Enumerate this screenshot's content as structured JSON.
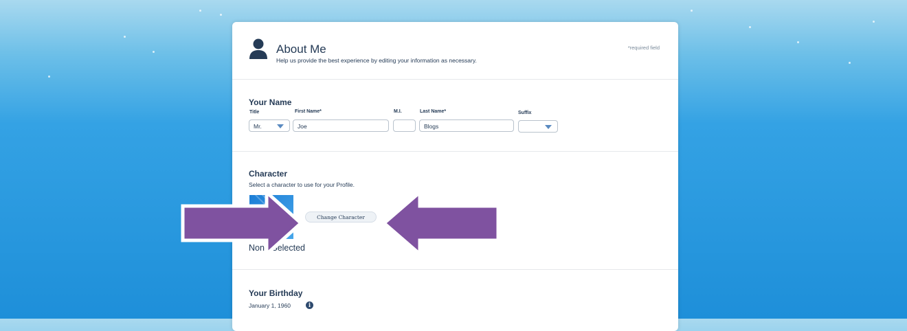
{
  "header": {
    "title": "About Me",
    "subtitle": "Help us provide the best experience by editing your information as necessary.",
    "required_note": "*required field",
    "icon": "person-icon"
  },
  "name_section": {
    "heading": "Your Name",
    "labels": {
      "title": "Title",
      "first_name": "First Name*",
      "middle_initial": "M.I.",
      "last_name": "Last Name*",
      "suffix": "Suffix"
    },
    "values": {
      "title": "Mr.",
      "first_name": "Joe",
      "middle_initial": "",
      "last_name": "Blogs",
      "suffix": ""
    }
  },
  "character_section": {
    "heading": "Character",
    "subtitle": "Select a character to use for your Profile.",
    "change_button": "Change Character",
    "status": "None Selected"
  },
  "birthday_section": {
    "heading": "Your Birthday",
    "value": "January 1, 1960",
    "info_icon": "info-icon"
  },
  "annotations": {
    "arrow_color": "#7f52a0",
    "arrow_count": 2
  },
  "colors": {
    "text_primary": "#253b56",
    "background_blue": "#1e8fd9",
    "select_arrow": "#5a8ac0"
  }
}
